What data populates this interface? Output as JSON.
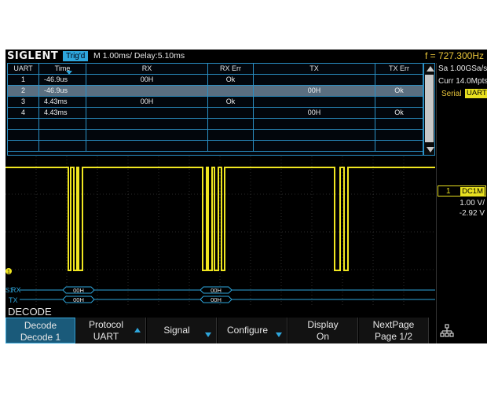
{
  "topbar": {
    "brand": "SIGLENT",
    "trigger_status": "Trig'd",
    "timebase": "M 1.00ms/ Delay:5.10ms",
    "frequency": "f = 727.300Hz"
  },
  "table": {
    "headers": [
      "UART",
      "Time",
      "RX",
      "RX Err",
      "TX",
      "TX Err"
    ],
    "rows": [
      [
        "1",
        "-46.9us",
        "00H",
        "Ok",
        "",
        ""
      ],
      [
        "2",
        "-46.9us",
        "",
        "",
        "00H",
        "Ok"
      ],
      [
        "3",
        "4.43ms",
        "00H",
        "Ok",
        "",
        ""
      ],
      [
        "4",
        "4.43ms",
        "",
        "",
        "00H",
        "Ok"
      ],
      [
        "",
        "",
        "",
        "",
        "",
        ""
      ],
      [
        "",
        "",
        "",
        "",
        "",
        ""
      ],
      [
        "",
        "",
        "",
        "",
        "",
        ""
      ]
    ],
    "selected_row": 2
  },
  "right_panel": {
    "sample_rate": "Sa 1.00GSa/s",
    "memory_depth": "Curr 14.0Mpts",
    "serial_label": "Serial",
    "serial_protocol": "UART",
    "channel_number": "1",
    "channel_coupling": "DC1M",
    "channel_scale": "1.00 V/",
    "channel_offset": "-2.92 V"
  },
  "bus": {
    "marker": "S1",
    "rx_label": "RX",
    "tx_label": "TX",
    "rx_values": [
      "00H",
      "00H"
    ],
    "tx_values": [
      "00H",
      "00H"
    ]
  },
  "waveform": {
    "color": "#f0e620",
    "channel_marker": "1"
  },
  "menu_title": "DECODE",
  "softkeys": [
    {
      "line1": "Decode",
      "line2": "Decode 1",
      "arrow": ""
    },
    {
      "line1": "Protocol",
      "line2": "UART",
      "arrow": "up"
    },
    {
      "line1": "Signal",
      "line2": "",
      "arrow": "down"
    },
    {
      "line1": "Configure",
      "line2": "",
      "arrow": "down"
    },
    {
      "line1": "Display",
      "line2": "On",
      "arrow": ""
    },
    {
      "line1": "NextPage",
      "line2": "Page 1/2",
      "arrow": ""
    }
  ],
  "colors": {
    "accent": "#2ea6dc",
    "trace": "#f0e620",
    "frequency": "#e8c53a"
  }
}
